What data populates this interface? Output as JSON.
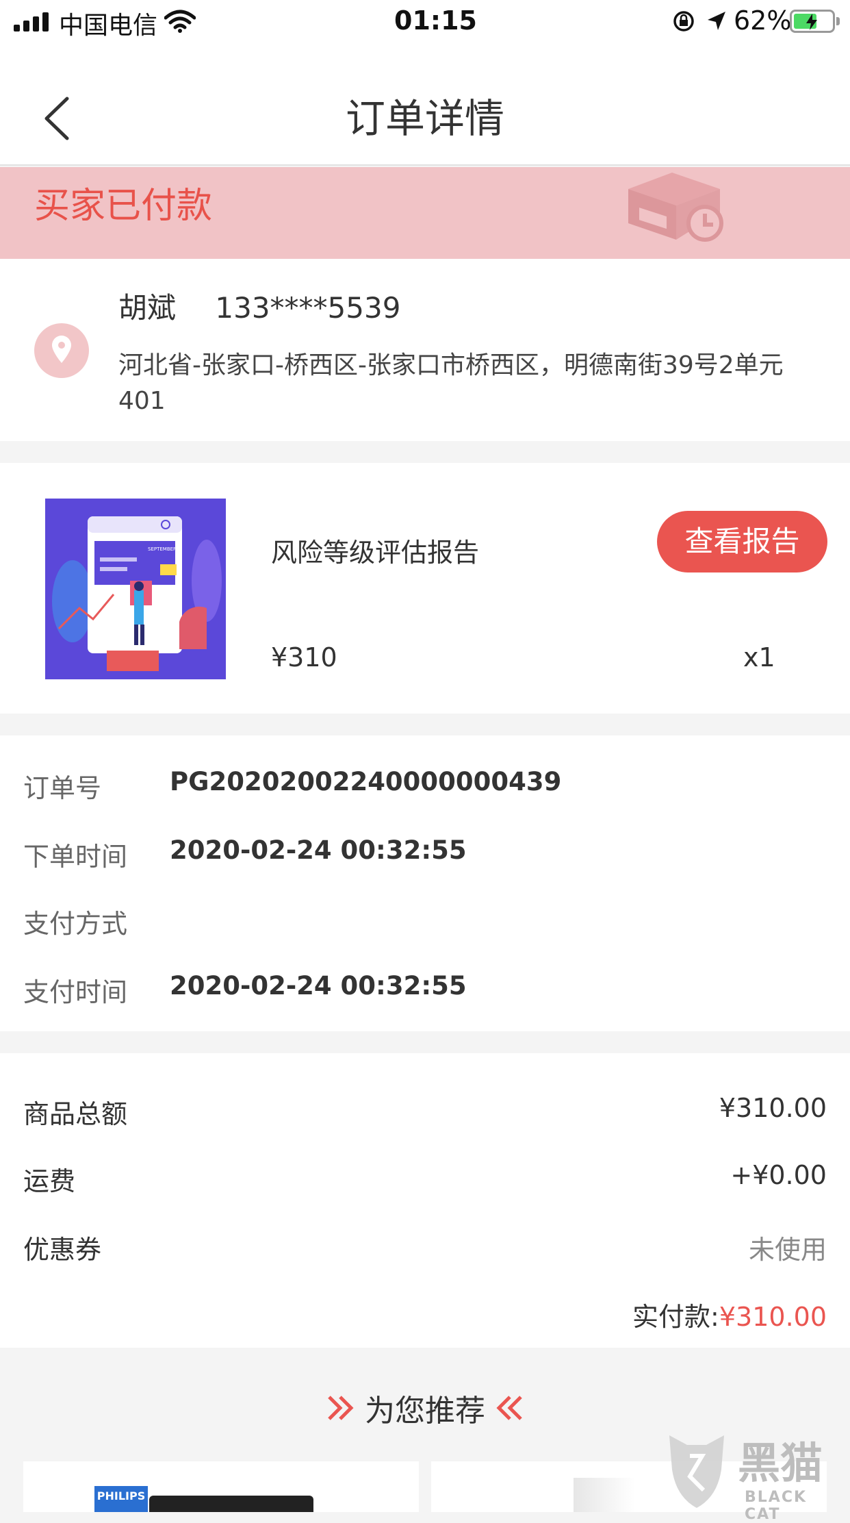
{
  "status_bar": {
    "carrier": "中国电信",
    "time": "01:15",
    "battery_percent": "62%",
    "battery_level": 0.62
  },
  "nav": {
    "title": "订单详情"
  },
  "order_status": {
    "text": "买家已付款"
  },
  "address": {
    "name": "胡斌",
    "phone": "133****5539",
    "line": "河北省-张家口-桥西区-张家口市桥西区，明德南街39号2单元401"
  },
  "product": {
    "name": "风险等级评估报告",
    "price": "¥310",
    "quantity": "x1",
    "report_button": "查看报告",
    "thumb_text": "SEPTEMBER"
  },
  "order_info": {
    "rows": [
      {
        "label": "订单号",
        "value": "PG20202002240000000439"
      },
      {
        "label": "下单时间",
        "value": "2020-02-24 00:32:55"
      },
      {
        "label": "支付方式",
        "value": ""
      },
      {
        "label": "支付时间",
        "value": "2020-02-24 00:32:55"
      }
    ]
  },
  "amounts": {
    "rows": [
      {
        "label": "商品总额",
        "value": "¥310.00"
      },
      {
        "label": "运费",
        "value": "+¥0.00"
      },
      {
        "label": "优惠券",
        "value": "未使用"
      }
    ],
    "paid_label": "实付款:",
    "paid_value": "¥310.00"
  },
  "recommend": {
    "title": "为您推荐",
    "card_brand": "PHILIPS"
  },
  "watermark": {
    "text": "黑猫",
    "sub": "BLACK CAT"
  },
  "colors": {
    "accent": "#ea5550",
    "banner_bg": "#f1c3c6",
    "page_bg": "#f4f4f4"
  }
}
